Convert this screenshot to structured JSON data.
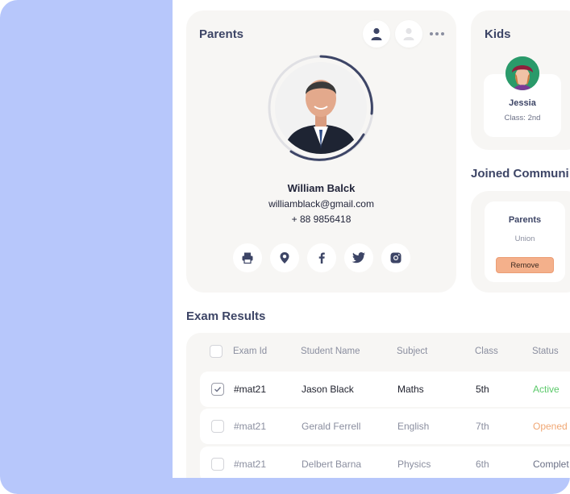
{
  "parents": {
    "title": "Parents",
    "name": "William Balck",
    "email": "williamblack@gmail.com",
    "phone": "+ 88 9856418",
    "header_icons": [
      "user-icon",
      "user-outline-icon",
      "more-dots-icon"
    ],
    "social_icons": [
      "print-icon",
      "location-pin-icon",
      "facebook-icon",
      "twitter-icon",
      "instagram-icon"
    ]
  },
  "kids": {
    "title": "Kids",
    "items": [
      {
        "name": "Jessia",
        "class": "Class: 2nd"
      }
    ]
  },
  "community": {
    "title": "Joined Communi",
    "items": [
      {
        "name": "Parents",
        "sub": "Union",
        "action": "Remove"
      }
    ]
  },
  "exam": {
    "title": "Exam Results",
    "columns": [
      "Exam Id",
      "Student Name",
      "Subject",
      "Class",
      "Status"
    ],
    "rows": [
      {
        "checked": true,
        "id": "#mat21",
        "student": "Jason Black",
        "subject": "Maths",
        "class": "5th",
        "status": "Active",
        "status_color": "#5bc96a"
      },
      {
        "checked": false,
        "id": "#mat21",
        "student": "Gerald Ferrell",
        "subject": "English",
        "class": "7th",
        "status": "Opened",
        "status_color": "#f0a774"
      },
      {
        "checked": false,
        "id": "#mat21",
        "student": "Delbert Barna",
        "subject": "Physics",
        "class": "6th",
        "status": "Complet",
        "status_color": "#6b7086"
      }
    ]
  },
  "colors": {
    "background_accent": "#b7c7fb",
    "card_bg": "#f7f6f4",
    "title_text": "#3d4566",
    "remove_button": "#f4b08b"
  }
}
